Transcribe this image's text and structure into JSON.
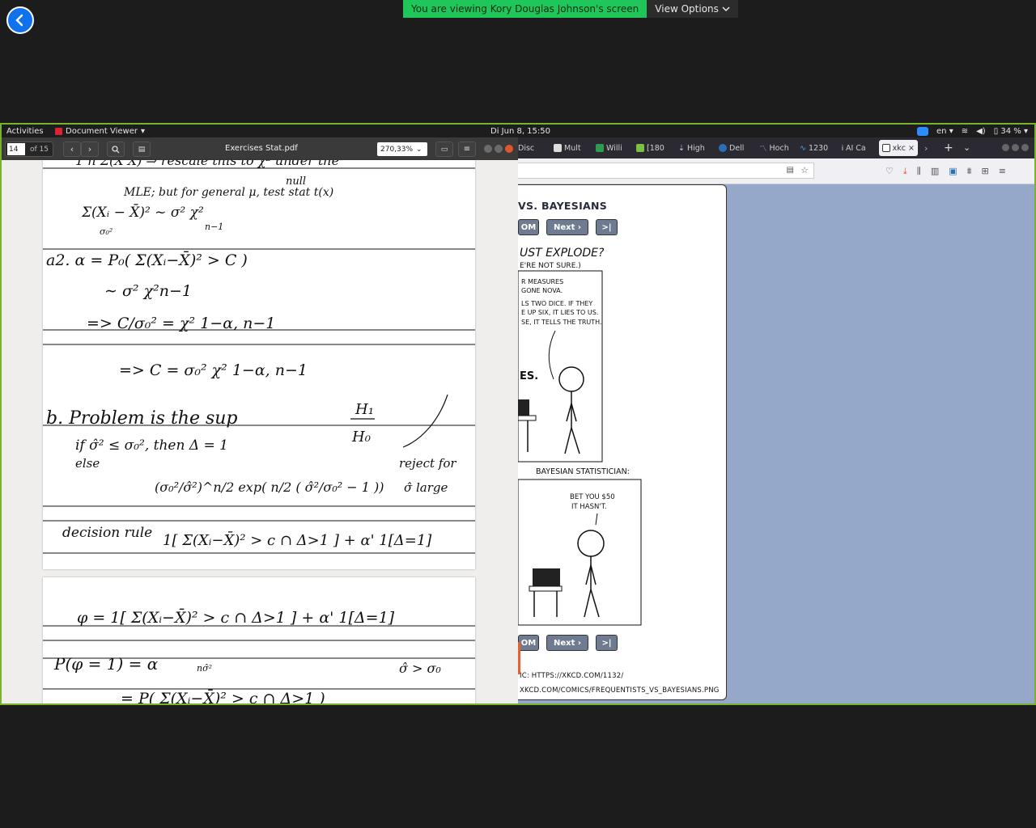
{
  "zoom_share": {
    "banner_text": "You are viewing Kory Douglas Johnson's screen",
    "view_options_label": "View Options"
  },
  "desktop": {
    "activities_label": "Activities",
    "app_menu_label": "Document Viewer",
    "clock": "Di Jun  8, 15:50",
    "language": "en",
    "battery": "34 %"
  },
  "document_viewer": {
    "page_current": "14",
    "page_total": "of 15",
    "title": "Exercises Stat.pdf",
    "zoom": "270,33%"
  },
  "firefox": {
    "tabs": [
      {
        "label": "Disc",
        "icon": "discord-icon"
      },
      {
        "label": "Mult",
        "icon": "document-icon"
      },
      {
        "label": "Willi",
        "icon": "green-doc-icon"
      },
      {
        "label": "[180",
        "icon": "green-badge-icon"
      },
      {
        "label": "High",
        "icon": "arrow-icon"
      },
      {
        "label": "Dell",
        "icon": "dell-icon"
      },
      {
        "label": "Hoch",
        "icon": "chart-icon"
      },
      {
        "label": "1230",
        "icon": "wave-icon"
      },
      {
        "label": "AI Ca",
        "icon": "ai-icon"
      },
      {
        "label": "xkc",
        "icon": "xkcd-icon",
        "active": true
      }
    ],
    "comic": {
      "title": "VS. BAYESIANS",
      "buttons_top": [
        "OM",
        "Next ›",
        ">|"
      ],
      "buttons_bottom": [
        "OM",
        "Next ›",
        ">|"
      ],
      "panel1_text": [
        "UST EXPLODE?",
        "E'RE NOT SURE.)"
      ],
      "panel1_speech": [
        "R MEASURES",
        "GONE NOVA.",
        "LS TWO DICE. IF THEY",
        "E UP SIX, IT LIES TO US.",
        "SE, IT TELLS THE TRUTH."
      ],
      "panel1_fragments": [
        "ES."
      ],
      "panel2_caption": "BAYESIAN STATISTICIAN:",
      "panel2_speech": [
        "BET YOU $50",
        "IT HASN'T."
      ],
      "permalink": "IC: HTTPS://XKCD.COM/1132/",
      "image_url": "XKCD.COM/COMICS/FREQUENTISTS_VS_BAYESIANS.PNG"
    }
  },
  "notes": {
    "page_top": [
      "MLE; but for general μ, test stat t(x)",
      "null",
      "a2. α = P₀( Σ(Xᵢ−X̄)² > C )",
      "∼ σ² χ²n−1",
      "=> C/σ₀² = χ² 1−α, n−1",
      "=> C = σ₀² χ² 1−α, n−1",
      "b. Problem is the sup",
      "H₁",
      "H₀",
      "if σ̂² ≤ σ₀², then Δ = 1",
      "else",
      "(σ₀²/σ̂²)^n/2 exp( n/2 ( σ̂²/σ₀² − 1 ))",
      "reject for",
      "σ̂ large",
      "decision rule",
      "1[ Σ(Xᵢ−X̄)² > c ∩ Δ>1 ] + α' 1[Δ=1]"
    ],
    "page_bottom": [
      "φ = 1[ Σ(Xᵢ−X̄)² > c ∩ Δ>1 ] + α' 1[Δ=1]",
      "P(φ = 1) = α",
      "nσ̂²",
      "σ̂ > σ₀",
      "= P( Σ(Xᵢ−X̄)² > c ∩ Δ>1 )"
    ]
  }
}
